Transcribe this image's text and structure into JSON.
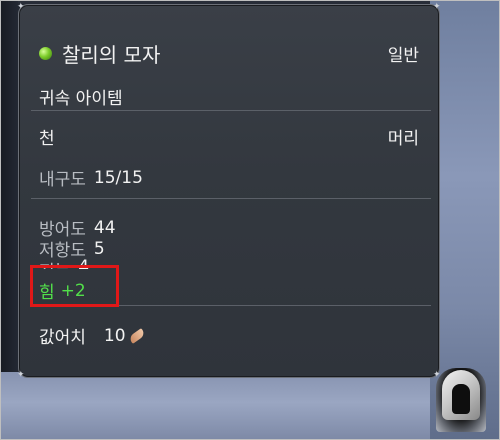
{
  "item": {
    "name": "찰리의 모자",
    "grade": "일반",
    "binding": "귀속 아이템",
    "material": "천",
    "slot": "머리",
    "durability_label": "내구도",
    "durability_value": "15/15",
    "stats": [
      {
        "label": "방어도",
        "value": "44"
      },
      {
        "label": "저항도",
        "value": "5"
      },
      {
        "label": "지능",
        "value": "4"
      }
    ],
    "bonus": {
      "label": "힘",
      "value": "+2"
    },
    "price_label": "값어치",
    "price_value": "10"
  },
  "icons": {
    "rarity": "green-gem-icon",
    "currency": "feather-coin-icon",
    "portrait": "hooded-character-portrait"
  },
  "colors": {
    "bonus_text": "#52e04a",
    "highlight": "#e01818",
    "gem": "#7ccc2a"
  }
}
